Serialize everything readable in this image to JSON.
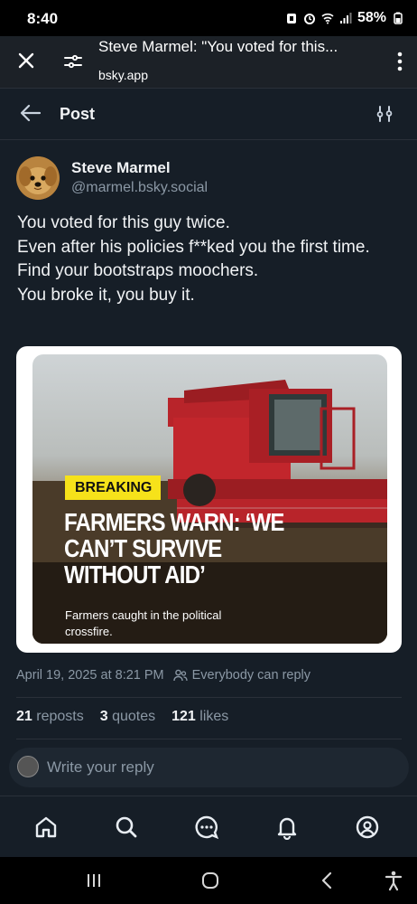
{
  "status_bar": {
    "time": "8:40",
    "battery": "58%"
  },
  "browser": {
    "tab_title": "Steve Marmel: \"You voted for this...",
    "url": "bsky.app"
  },
  "header": {
    "title": "Post"
  },
  "post": {
    "author_name": "Steve Marmel",
    "author_handle": "@marmel.bsky.social",
    "text_lines": [
      "You voted for this guy twice.",
      "Even after his policies f**ked you the first time.",
      "Find your bootstraps moochers.",
      "You broke it, you buy it."
    ],
    "image": {
      "badge": "BREAKING",
      "headline": "FARMERS WARN: ‘WE CAN’T SURVIVE WITHOUT AID’",
      "caption": "Farmers caught in the political crossfire."
    },
    "timestamp": "April 19, 2025 at 8:21 PM",
    "reply_setting": "Everybody can reply",
    "stats": {
      "reposts_count": "21",
      "reposts_label": "reposts",
      "quotes_count": "3",
      "quotes_label": "quotes",
      "likes_count": "121",
      "likes_label": "likes"
    }
  },
  "reply_box": {
    "placeholder": "Write your reply"
  },
  "colors": {
    "background": "#161e27",
    "text": "#f1f3f5",
    "muted": "#8b98a5",
    "badge": "#f6e21a"
  },
  "icons": {
    "tabbar": [
      "home-icon",
      "search-icon",
      "chat-icon",
      "notifications-icon",
      "profile-icon"
    ],
    "android_nav": [
      "recent-apps-icon",
      "home-button-icon",
      "back-icon",
      "accessibility-icon"
    ]
  }
}
